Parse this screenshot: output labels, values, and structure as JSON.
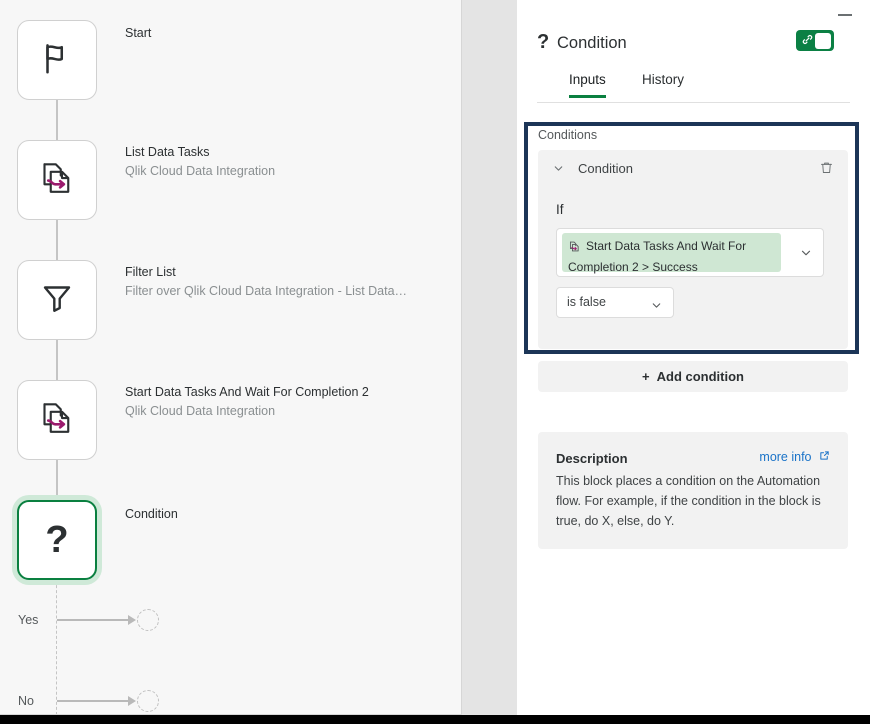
{
  "canvas": {
    "nodes": [
      {
        "icon": "flag-icon",
        "title": "Start",
        "subtitle": ""
      },
      {
        "icon": "data-task-icon",
        "title": "List Data Tasks",
        "subtitle": "Qlik Cloud Data Integration"
      },
      {
        "icon": "filter-icon",
        "title": "Filter List",
        "subtitle": "Filter over Qlik Cloud Data Integration - List Data…"
      },
      {
        "icon": "data-task-icon",
        "title": "Start Data Tasks And Wait For Completion 2",
        "subtitle": "Qlik Cloud Data Integration"
      },
      {
        "icon": "question-icon",
        "title": "Condition",
        "subtitle": ""
      }
    ],
    "branches": [
      {
        "label": "Yes"
      },
      {
        "label": "No"
      }
    ]
  },
  "panel": {
    "icon": "question-icon",
    "title": "Condition",
    "minimize_label": "minimize-icon",
    "toggle": {
      "name": "enabled-toggle",
      "state": "on",
      "color": "#0b8044",
      "icon": "link-icon"
    },
    "tabs": [
      {
        "label": "Inputs",
        "active": true
      },
      {
        "label": "History",
        "active": false
      }
    ],
    "conditions_label": "Conditions",
    "condition": {
      "name": "Condition",
      "collapse_icon": "chevron-down-icon",
      "delete_icon": "trash-icon",
      "if_label": "If",
      "token": {
        "icon": "data-task-icon",
        "line1": "Start Data Tasks And Wait For",
        "line2": "Completion 2 > Success",
        "caret_icon": "chevron-down-icon"
      },
      "operator": {
        "value": "is false",
        "caret_icon": "chevron-down-icon"
      }
    },
    "add_condition": {
      "plus": "+",
      "label": "Add condition"
    },
    "description": {
      "title": "Description",
      "more_info": "more info",
      "more_info_icon": "external-link-icon",
      "body": "This block places a condition on the Automation flow. For example, if the condition in the block is true, do X, else, do Y."
    },
    "highlight_color": "#1c3557",
    "accent_color": "#0a8040"
  }
}
